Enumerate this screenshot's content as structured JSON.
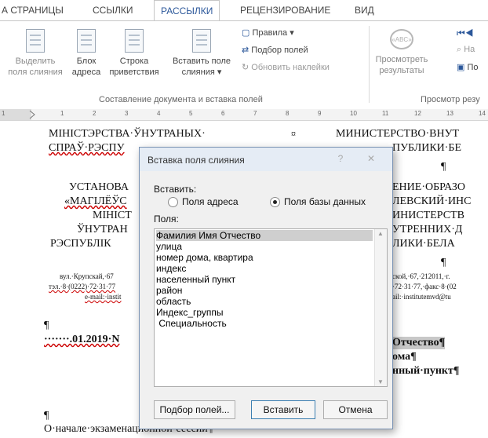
{
  "ribbon": {
    "tabs": [
      "А СТРАНИЦЫ",
      "ССЫЛКИ",
      "РАССЫЛКИ",
      "РЕЦЕНЗИРОВАНИЕ",
      "ВИД"
    ],
    "buttons": {
      "highlight_fields": [
        "Выделить",
        "поля слияния"
      ],
      "address_block": [
        "Блок",
        "адреса"
      ],
      "greeting_line": [
        "Строка",
        "приветствия"
      ],
      "insert_field": [
        "Вставить поле",
        "слияния ▾"
      ],
      "rules": "Правила ▾",
      "match_fields": "Подбор полей",
      "update_labels": "Обновить наклейки",
      "preview": [
        "Просмотреть",
        "результаты"
      ],
      "find_recipient": "На",
      "check_errors": "По"
    },
    "groups": {
      "write_insert": "Составление документа и вставка полей",
      "preview": "Просмотр резу"
    }
  },
  "ruler": {
    "numbers": [
      "1",
      "1",
      "2",
      "3",
      "4",
      "5",
      "6",
      "7",
      "8",
      "9",
      "10",
      "11",
      "12",
      "13",
      "14"
    ]
  },
  "document": {
    "left": {
      "line1": "МІНІСТЭРСТВА·ЎНУТРАНЫХ·",
      "line2": "СПРАЎ·РЭСПУ",
      "line3": "УСТАНОВА",
      "line4": "«МАГІЛЁЎС",
      "line5": "МІНІСТ",
      "line6": "ЎНУТРАН",
      "line7": "РЭСПУБЛІК",
      "addr1": "вул.·Крупскай,·67",
      "addr2": "тэл.·8·(0222)·72·31·77",
      "addr3": "e-mail:·instit",
      "pilcrow": "¶",
      "date": "·······.01.2019·N",
      "bottom_pilcrow": "¶",
      "bottom_line": "О·начале·экзаменационной·сессии¶"
    },
    "center_mark": "¤",
    "right": {
      "line1": "МИНИСТЕРСТВО·ВНУТ",
      "line2": "ПУБЛИКИ·БЕ",
      "pilcrow1": "¶",
      "line3": "ЕНИЕ·ОБРАЗО",
      "line4": "ЛЕВСКИЙ·ИНС",
      "line5": "ИНИСТЕРСТВ",
      "line6": "УТРЕННИХ·Д",
      "line7": "ЛИКИ·БЕЛА",
      "pilcrow2": "¶",
      "addr1": "ской,·67,·212011,·г.",
      "addr2": "·72·31·77,·факс·8·(02",
      "addr3": "ail:·institutemvd@tu",
      "field1": "Отчество¶",
      "field2": "ома¶",
      "field3": "нный·пункт¶"
    }
  },
  "dialog": {
    "title": "Вставка поля слияния",
    "help": "?",
    "close": "✕",
    "insert_label": "Вставить:",
    "radio_address": "Поля адреса",
    "radio_db": "Поля базы данных",
    "fields_label": "Поля:",
    "fields": [
      "Фамилия Имя Отчество",
      "улица",
      "номер дома, квартира",
      "индекс",
      "населенный пункт",
      "район",
      "область",
      "Индекс_группы",
      " Специальность"
    ],
    "btn_match": "Подбор полей...",
    "btn_insert": "Вставить",
    "btn_cancel": "Отмена"
  }
}
